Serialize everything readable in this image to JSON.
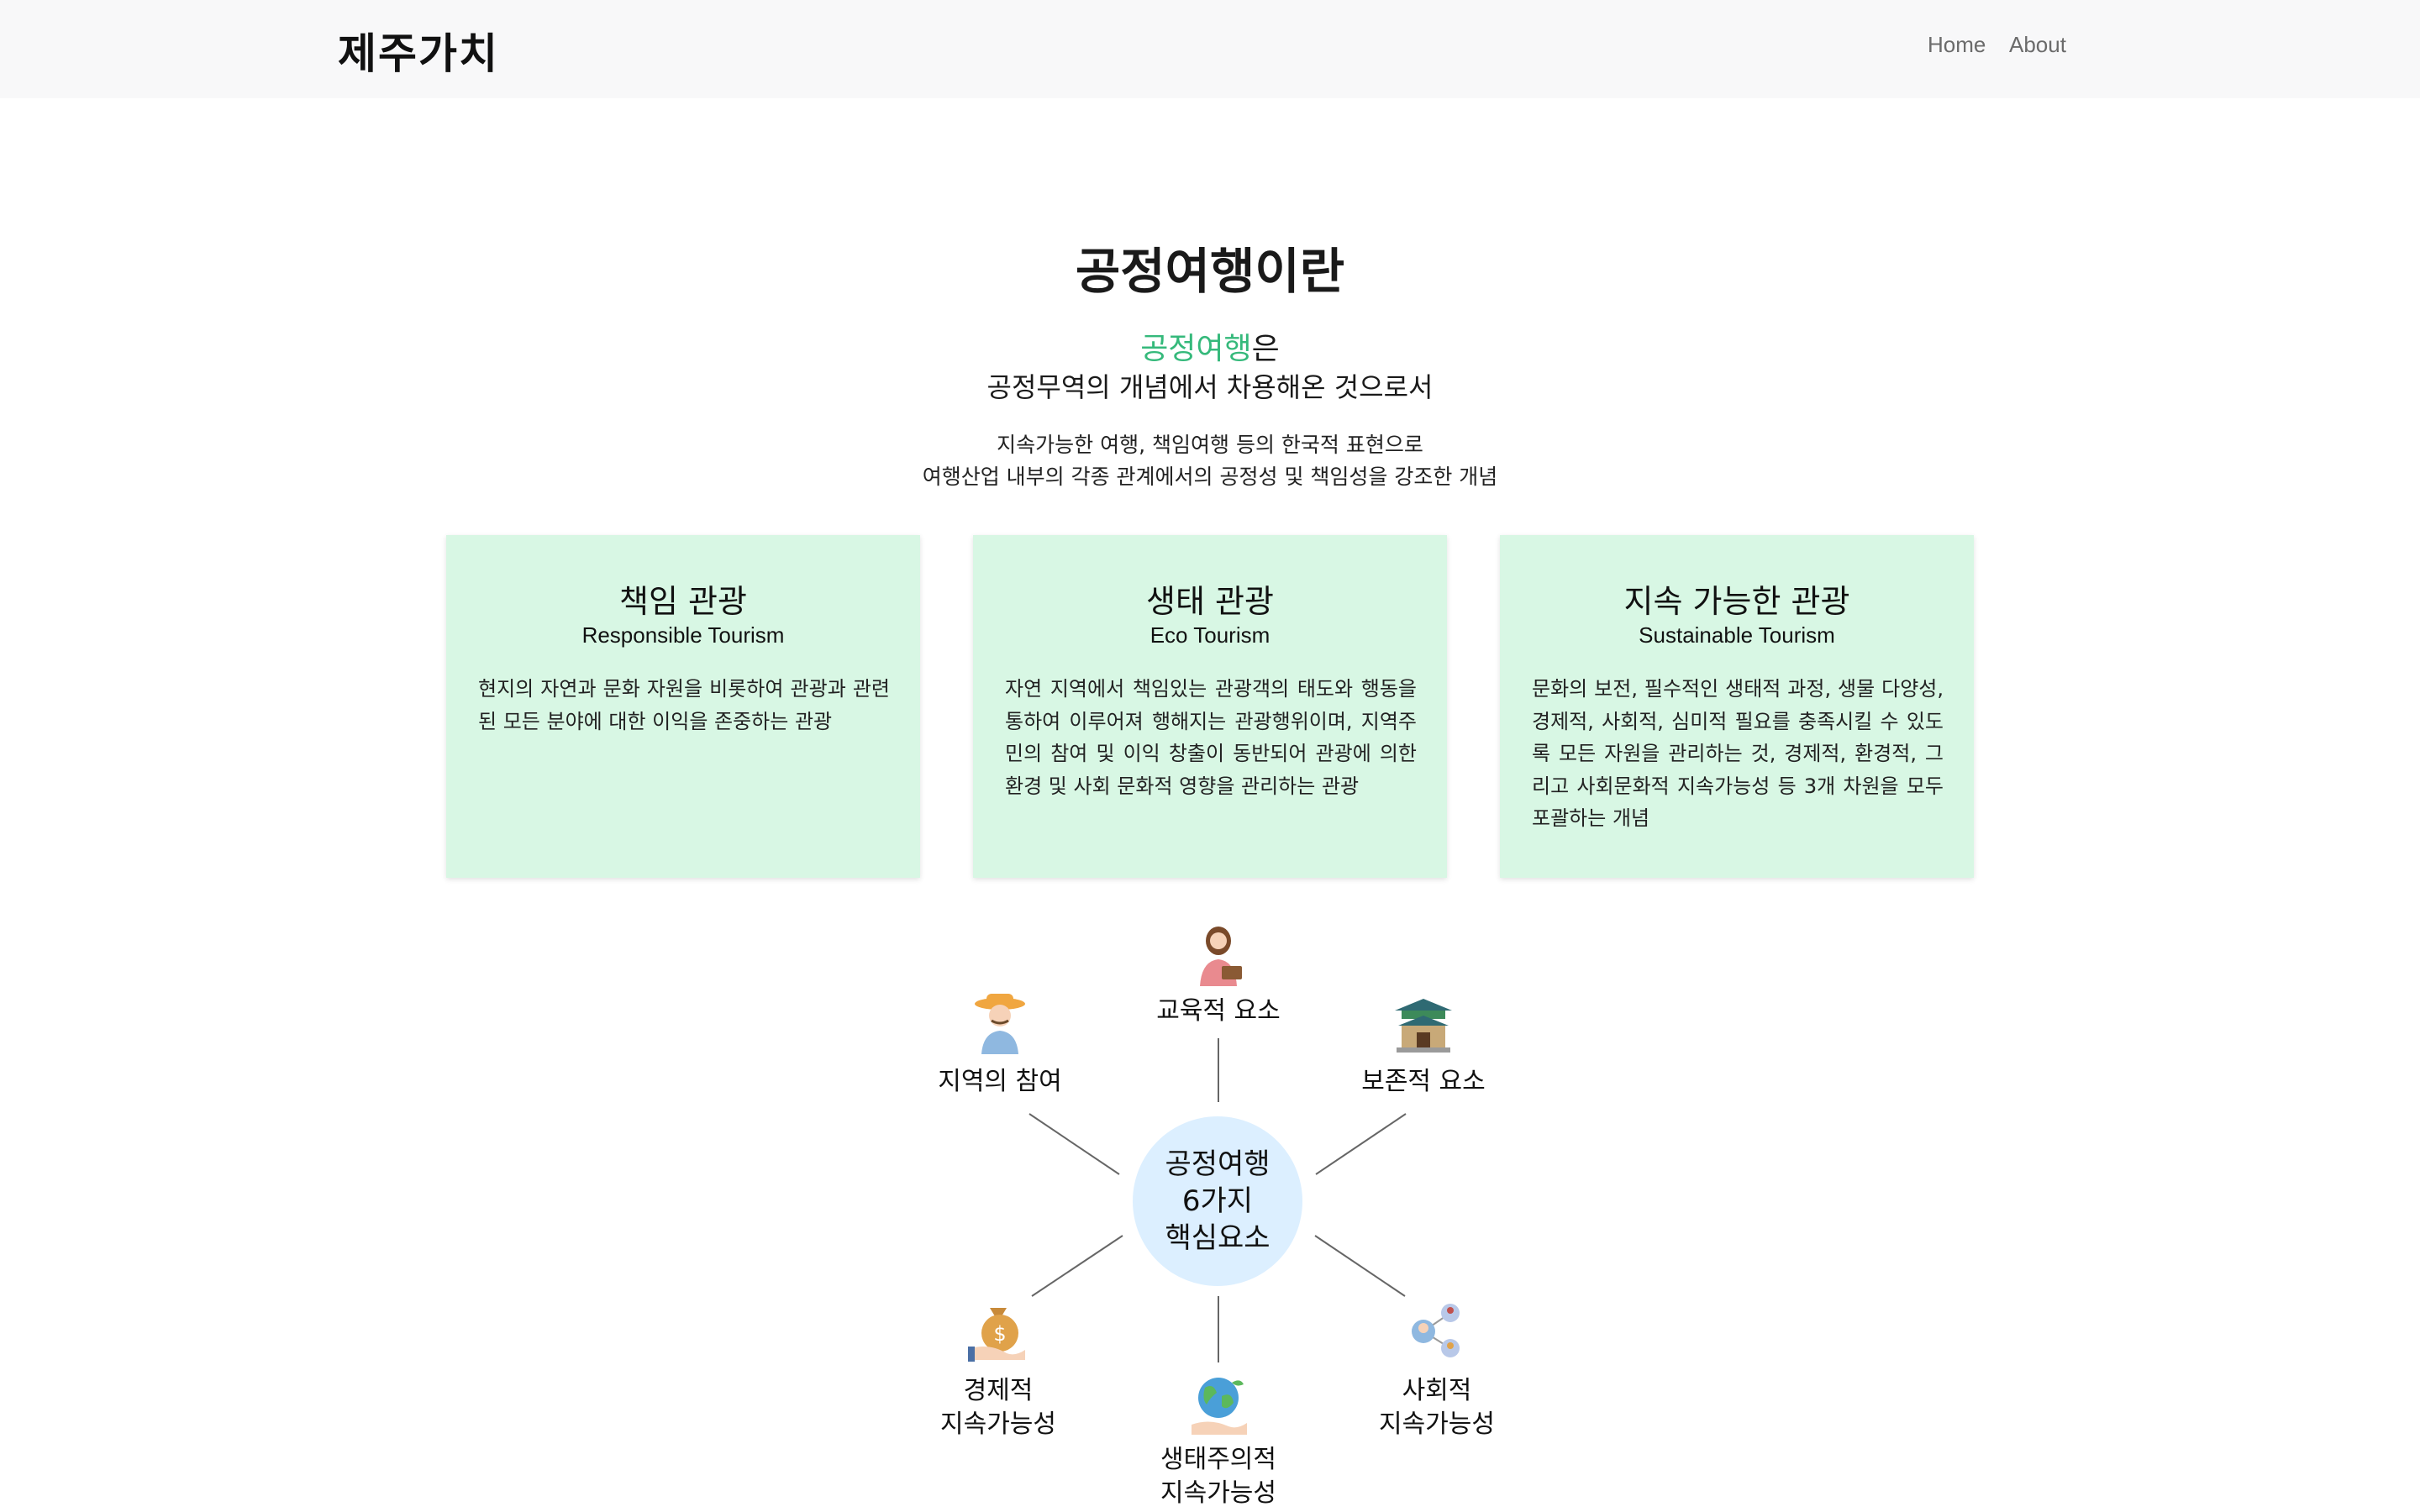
{
  "header": {
    "brand": "제주가치",
    "nav": [
      {
        "label": "Home"
      },
      {
        "label": "About"
      }
    ]
  },
  "intro": {
    "title": "공정여행이란",
    "line1_accent": "공정여행",
    "line1_rest": "은",
    "line2": "공정무역의 개념에서 차용해온 것으로서",
    "desc_line1": "지속가능한 여행, 책임여행 등의 한국적 표현으로",
    "desc_line2": "여행산업 내부의 각종 관계에서의 공정성 및 책임성을 강조한 개념"
  },
  "cards": [
    {
      "title": "책임 관광",
      "subtitle": "Responsible Tourism",
      "body": "현지의 자연과 문화 자원을 비롯하여 관광과 관련된 모든 분야에 대한 이익을 존중하는 관광"
    },
    {
      "title": "생태 관광",
      "subtitle": "Eco Tourism",
      "body": "자연 지역에서 책임있는 관광객의 태도와 행동을 통하여 이루어져 행해지는 관광행위이며, 지역주민의 참여 및 이익 창출이 동반되어 관광에 의한 환경 및 사회 문화적 영향을 관리하는 관광"
    },
    {
      "title": "지속 가능한 관광",
      "subtitle": "Sustainable Tourism",
      "body": "문화의 보전, 필수적인 생태적 과정, 생물 다양성, 경제적, 사회적, 심미적 필요를 충족시킬 수 있도록 모든 자원을 관리하는 것, 경제적, 환경적, 그리고 사회문화적 지속가능성 등 3개 차원을 모두 포괄하는 개념"
    }
  ],
  "diagram": {
    "hub": {
      "line1": "공정여행",
      "line2": "6가지",
      "line3": "핵심요소",
      "color": "#dcefff"
    },
    "nodes": [
      {
        "label": "교육적 요소",
        "icon": "teacher-icon"
      },
      {
        "label": "지역의 참여",
        "icon": "farmer-icon"
      },
      {
        "label": "보존적 요소",
        "icon": "heritage-gate-icon"
      },
      {
        "label1": "경제적",
        "label2": "지속가능성",
        "icon": "money-bag-icon"
      },
      {
        "label1": "생태주의적",
        "label2": "지속가능성",
        "icon": "earth-hand-icon"
      },
      {
        "label1": "사회적",
        "label2": "지속가능성",
        "icon": "people-network-icon"
      }
    ]
  },
  "colors": {
    "accent": "#35b97b",
    "card_bg": "#d8f7e4",
    "navbar_bg": "#f8f8f9"
  }
}
